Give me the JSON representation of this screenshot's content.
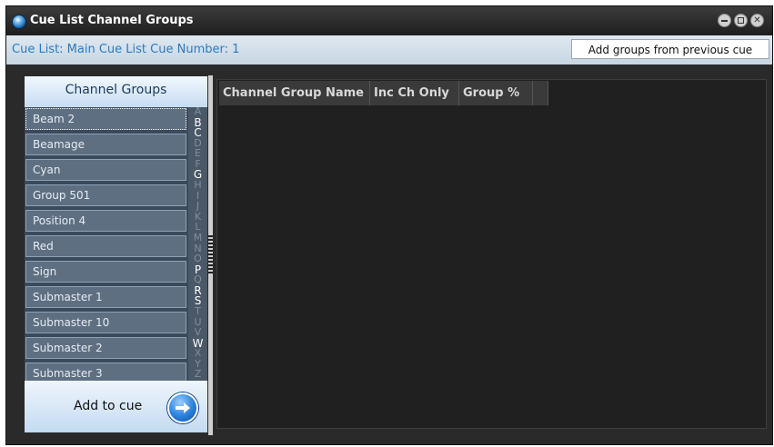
{
  "window": {
    "title": "Cue List Channel Groups"
  },
  "info_bar": {
    "cue_info": "Cue List: Main Cue List Cue Number: 1",
    "add_groups_button": "Add groups from previous cue"
  },
  "left_panel": {
    "header": "Channel Groups",
    "groups": [
      "Beam 2",
      "Beamage",
      "Cyan",
      "Group 501",
      "Position 4",
      "Red",
      "Sign",
      "Submaster 1",
      "Submaster 10",
      "Submaster 2",
      "Submaster 3"
    ],
    "alphabet": [
      "A",
      "B",
      "C",
      "D",
      "E",
      "F",
      "G",
      "H",
      "I",
      "J",
      "K",
      "L",
      "M",
      "N",
      "O",
      "P",
      "Q",
      "R",
      "S",
      "T",
      "U",
      "V",
      "W",
      "X",
      "Y",
      "Z"
    ],
    "active_letters": [
      "B",
      "C",
      "G",
      "P",
      "R",
      "S",
      "W"
    ],
    "add_to_cue_label": "Add to cue"
  },
  "table": {
    "columns": [
      "Channel Group Name",
      "Inc Ch Only",
      "Group %",
      ""
    ]
  }
}
